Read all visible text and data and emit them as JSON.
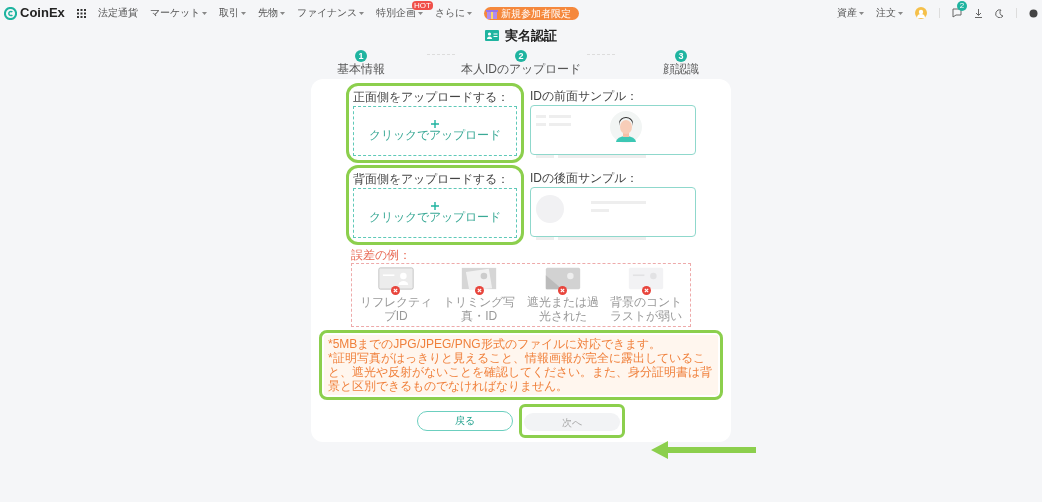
{
  "nav": {
    "logo": "CoinEx",
    "items": [
      {
        "label": "法定通貨",
        "dropdown": false
      },
      {
        "label": "マーケット",
        "dropdown": true
      },
      {
        "label": "取引",
        "dropdown": true
      },
      {
        "label": "先物",
        "dropdown": true
      },
      {
        "label": "ファイナンス",
        "dropdown": true
      },
      {
        "label": "特別企画",
        "dropdown": true,
        "badge": "HOT"
      },
      {
        "label": "さらに",
        "dropdown": true
      }
    ],
    "promo": "新規参加者限定",
    "right_items": [
      {
        "label": "資産",
        "dropdown": true
      },
      {
        "label": "注文",
        "dropdown": true
      }
    ],
    "message_badge": "2"
  },
  "page_title": "実名認証",
  "steps": [
    {
      "number": "1",
      "label": "基本情報"
    },
    {
      "number": "2",
      "label": "本人IDのアップロード"
    },
    {
      "number": "3",
      "label": "顔認識"
    }
  ],
  "uploads": [
    {
      "label": "正面側をアップロードする：",
      "button": "クリックでアップロード",
      "sample_label": "IDの前面サンプル：",
      "kind": "front"
    },
    {
      "label": "背面側をアップロードする：",
      "button": "クリックでアップロード",
      "sample_label": "IDの後面サンプル：",
      "kind": "back"
    }
  ],
  "errors": {
    "label": "誤差の例：",
    "examples": [
      {
        "label": "リフレクティブID",
        "kind": "reflective"
      },
      {
        "label": "トリミング写真・ID",
        "kind": "cropped"
      },
      {
        "label": "遮光または過光された",
        "kind": "shaded"
      },
      {
        "label": "背景のコントラストが弱い",
        "kind": "low_contrast"
      }
    ]
  },
  "notes": [
    "*5MBまでのJPG/JPEG/PNG形式のファイルに対応できます。",
    "*証明写真がはっきりと見えること、情報画報が完全に露出していること、遮光や反射がないことを確認してください。また、身分証明書は背景と区別できるものでなければなりません。"
  ],
  "buttons": [
    {
      "label": "戻る",
      "kind": "back",
      "disabled": false
    },
    {
      "label": "次へ",
      "kind": "next",
      "disabled": true
    }
  ]
}
